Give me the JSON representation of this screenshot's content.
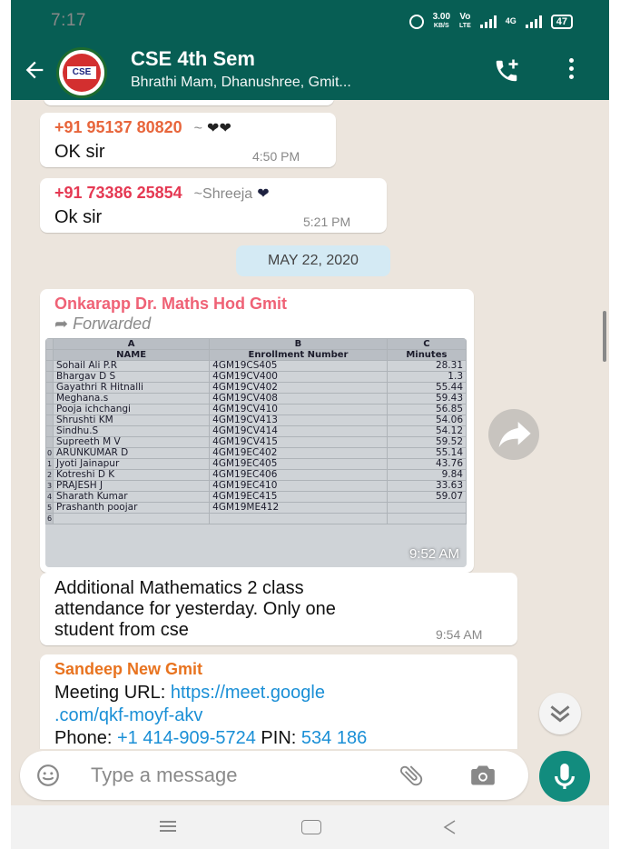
{
  "status_bar": {
    "time": "7:17",
    "speed_value": "3.00",
    "speed_unit": "KB/S",
    "volte_top": "Vo",
    "volte_bottom": "LTE",
    "net_type": "4G",
    "battery": "47"
  },
  "header": {
    "title": "CSE 4th Sem",
    "subtitle": "Bhrathi Mam, Dhanushree, Gmit...",
    "avatar_text": "CSE"
  },
  "messages": [
    {
      "sender": "+91 95137 80820",
      "sender_note": "~",
      "text": "OK sir",
      "time": "4:50 PM",
      "sender_color": "#e8663c"
    },
    {
      "sender": "+91 73386 25854",
      "sender_note": "~Shreeja",
      "text": "Ok sir",
      "time": "5:21 PM",
      "sender_color": "#e53953"
    }
  ],
  "date_separator": "MAY 22, 2020",
  "forwarded_message": {
    "sender": "Onkarapp Dr. Maths Hod Gmit",
    "sender_color": "#ef6276",
    "forwarded_label": "Forwarded",
    "image_time": "9:52 AM",
    "sheet": {
      "col_letters": [
        "A",
        "B",
        "C"
      ],
      "headers": [
        "NAME",
        "Enrollment Number",
        "Minutes"
      ],
      "rows": [
        [
          "",
          "Sohail Ali P.R",
          "4GM19CS405",
          "28.31"
        ],
        [
          "",
          "Bhargav D S",
          "4GM19CV400",
          "1.3"
        ],
        [
          "",
          "Gayathri R Hitnalli",
          "4GM19CV402",
          "55.44"
        ],
        [
          "",
          "Meghana.s",
          "4GM19CV408",
          "59.43"
        ],
        [
          "",
          "Pooja ichchangi",
          "4GM19CV410",
          "56.85"
        ],
        [
          "",
          "Shrushti KM",
          "4GM19CV413",
          "54.06"
        ],
        [
          "",
          "Sindhu.S",
          "4GM19CV414",
          "54.12"
        ],
        [
          "",
          "Supreeth M V",
          "4GM19CV415",
          "59.52"
        ],
        [
          "0",
          "ARUNKUMAR D",
          "4GM19EC402",
          "55.14"
        ],
        [
          "1",
          "Jyoti Jainapur",
          "4GM19EC405",
          "43.76"
        ],
        [
          "2",
          "Kotreshi D K",
          "4GM19EC406",
          "9.84"
        ],
        [
          "3",
          "PRAJESH J",
          "4GM19EC410",
          "33.63"
        ],
        [
          "4",
          "Sharath Kumar",
          "4GM19EC415",
          "59.07"
        ],
        [
          "5",
          "Prashanth poojar",
          "4GM19ME412",
          ""
        ],
        [
          "6",
          "",
          "",
          ""
        ]
      ]
    }
  },
  "caption_message": {
    "text_line1": "Additional  Mathematics 2 class",
    "text_line2": "attendance for yesterday. Only one",
    "text_line3": "student from cse",
    "time": "9:54 AM"
  },
  "meeting_message": {
    "sender": "Sandeep New Gmit",
    "sender_color": "#e8731f",
    "line1_label": "Meeting URL: ",
    "line1_link": "https://meet.google",
    "line2_link": ".com/qkf-moyf-akv",
    "line3_label": "Phone: ",
    "line3_phone": "+1 414-909-5724",
    "line3_pin_label": " PIN: ",
    "line3_pin": "534 186"
  },
  "input": {
    "placeholder": "Type a message"
  },
  "colors": {
    "header": "#075e54",
    "chat_bg": "#ece5dd",
    "mic": "#128c7e",
    "link": "#1a8fd6"
  }
}
